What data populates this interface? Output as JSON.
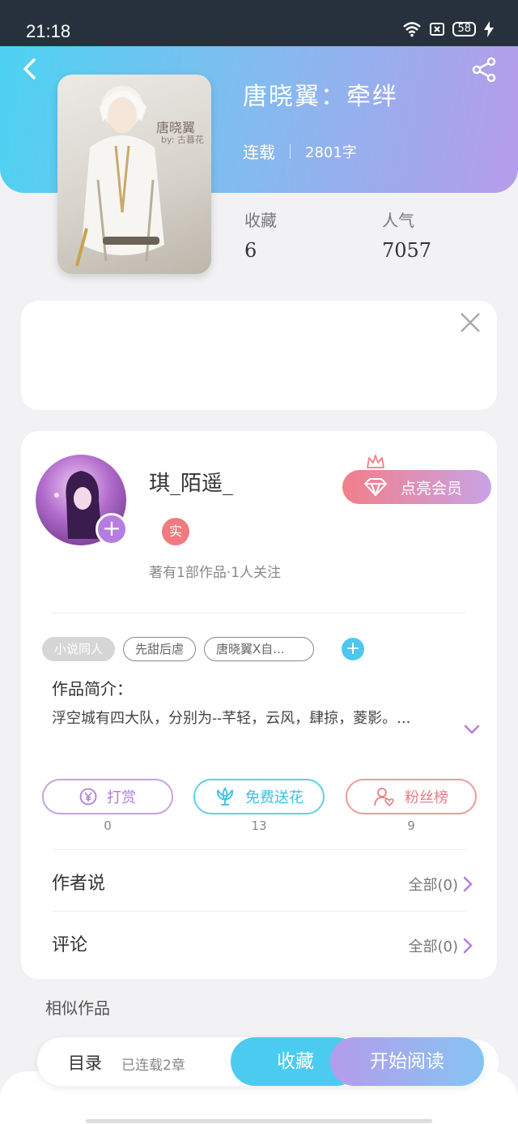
{
  "status_bar": {
    "time": "21:18",
    "battery": "58"
  },
  "book": {
    "title": "唐晓翼：牵绊",
    "status": "连载",
    "word_count": "2801字",
    "cover_title": "唐晓翼",
    "cover_byline": "by: 古暮花"
  },
  "stats": [
    {
      "label": "收藏",
      "value": "6"
    },
    {
      "label": "人气",
      "value": "7057"
    }
  ],
  "author": {
    "name": "琪_陌遥_",
    "badge": "实",
    "info": "著有1部作品·1人关注",
    "vip_label": "点亮会员"
  },
  "tags": [
    "小说同人",
    "先甜后虐",
    "唐晓翼X自..."
  ],
  "intro": {
    "label": "作品简介：",
    "text": "浮空城有四大队，分别为--芊轻，云风，肆掠，菱影。..."
  },
  "actions": [
    {
      "label": "打赏",
      "count": "0"
    },
    {
      "label": "免费送花",
      "count": "13"
    },
    {
      "label": "粉丝榜",
      "count": "9"
    }
  ],
  "rows": {
    "author_says": {
      "label": "作者说",
      "link": "全部(0)"
    },
    "comments": {
      "label": "评论",
      "link": "全部(0)"
    }
  },
  "similar_label": "相似作品",
  "bottom_bar": {
    "toc_label": "目录",
    "toc_sub": "已连载2章",
    "collect_label": "收藏",
    "read_label": "开始阅读"
  },
  "colors": {
    "header_start": "#4dd2f2",
    "header_end": "#b69cea",
    "accent_blue": "#4cc7ee",
    "accent_purple": "#b57de0",
    "accent_pink": "#f27f89"
  },
  "icons": [
    "back-arrow-icon",
    "share-icon",
    "close-icon",
    "crown-icon",
    "diamond-icon",
    "yuan-icon",
    "flower-icon",
    "user-heart-icon",
    "chevron-right-icon",
    "chevron-down-icon",
    "wifi-icon",
    "battery-icon",
    "bolt-icon"
  ]
}
